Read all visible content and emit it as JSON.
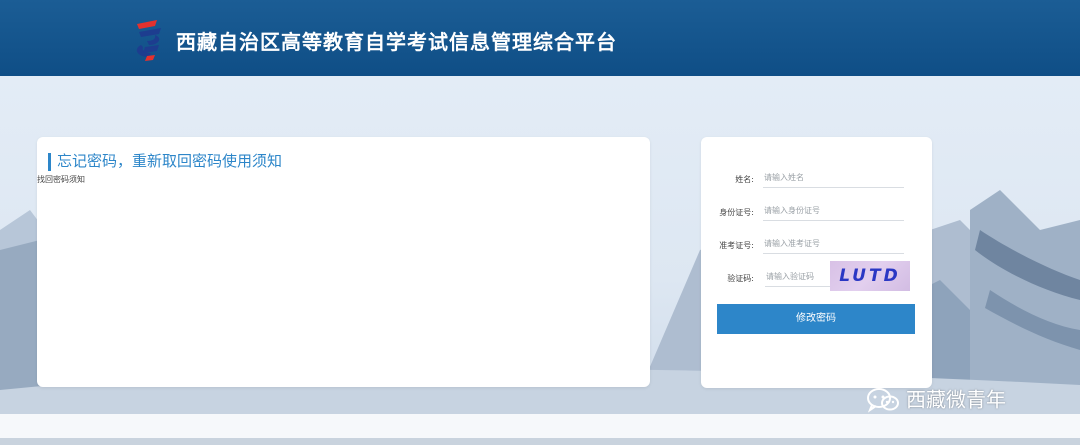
{
  "header": {
    "title": "西藏自治区高等教育自学考试信息管理综合平台",
    "logo_icon": "exam-logo-icon",
    "colors": {
      "background": "#0f4e86",
      "logo_red": "#e4312d",
      "logo_blue": "#1d3d8f"
    }
  },
  "notice": {
    "title": "忘记密码，重新取回密码使用须知",
    "subtitle": "找回密码须知",
    "accent_color": "#2d86c9"
  },
  "form": {
    "fields": [
      {
        "label": "姓名:",
        "placeholder": "请输入姓名"
      },
      {
        "label": "身份证号:",
        "placeholder": "请输入身份证号"
      },
      {
        "label": "准考证号:",
        "placeholder": "请输入准考证号"
      },
      {
        "label": "验证码:",
        "placeholder": "请输入验证码"
      }
    ],
    "captcha_text": "LUTD",
    "submit_label": "修改密码",
    "button_color": "#2d86c9"
  },
  "watermark": {
    "icon": "wechat-icon",
    "text": "西藏微青年"
  }
}
